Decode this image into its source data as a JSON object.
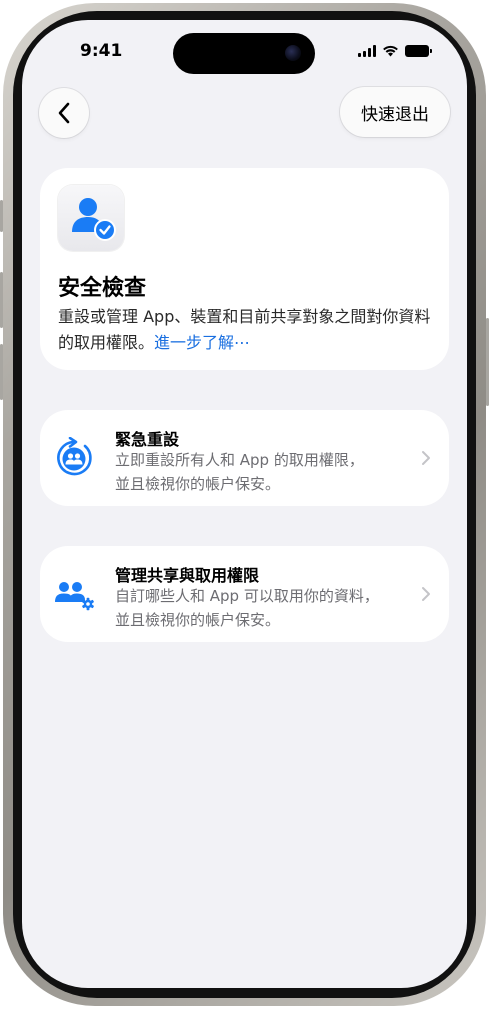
{
  "status_bar": {
    "time": "9:41"
  },
  "nav": {
    "back_icon": "chevron-left-icon",
    "quick_exit_label": "快速退出"
  },
  "hero": {
    "icon": "person-checkmark-icon",
    "title": "安全檢查",
    "description": "重設或管理 App、裝置和目前共享對象之間對你資料的取用權限。",
    "link_text": "進一步了解⋯"
  },
  "options": [
    {
      "icon": "person-reset-icon",
      "title": "緊急重設",
      "line1": "立即重設所有人和 App 的取用權限，",
      "line2": "並且檢視你的帳户保安。"
    },
    {
      "icon": "people-gear-icon",
      "title": "管理共享與取用權限",
      "line1": "自訂哪些人和 App 可以取用你的資料，",
      "line2": "並且檢視你的帳户保安。"
    }
  ],
  "colors": {
    "accent": "#1a6fe0",
    "background": "#f2f2f6",
    "card": "#ffffff"
  }
}
